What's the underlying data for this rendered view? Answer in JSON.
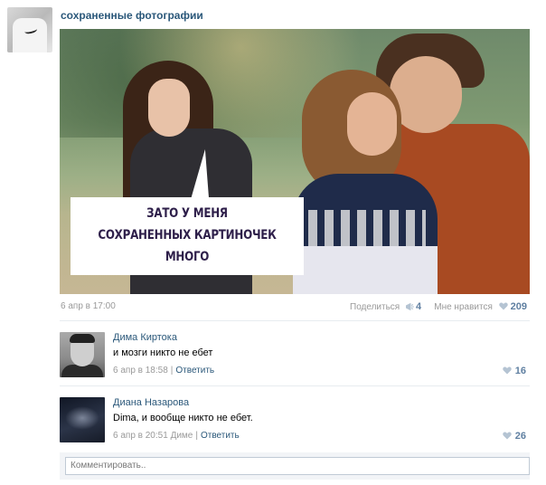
{
  "post": {
    "group_name": "сохраненные фотографии",
    "image_caption": "ЗАТО У МЕНЯ\nСОХРАНЕННЫХ КАРТИНОЧЕК\nМНОГО",
    "date": "6 апр в 17:00",
    "share_label": "Поделиться",
    "share_count": "4",
    "like_label": "Мне нравится",
    "like_count": "209"
  },
  "comments": [
    {
      "author": "Дима Киртока",
      "text": "и мозги никто не ебет",
      "date": "6 апр в 18:58",
      "reply_to": "",
      "reply_label": "Ответить",
      "likes": "16"
    },
    {
      "author": "Диана Назарова",
      "text": "Dima, и вообще никто не ебет.",
      "date": "6 апр в 20:51",
      "reply_to": "Диме",
      "reply_label": "Ответить",
      "likes": "26"
    }
  ],
  "comment_input": {
    "placeholder": "Комментировать.."
  },
  "icons": {
    "share": "megaphone-icon",
    "like": "heart-icon"
  },
  "colors": {
    "link": "#2b587a",
    "meta": "#999999",
    "count": "#5f7fa1"
  }
}
